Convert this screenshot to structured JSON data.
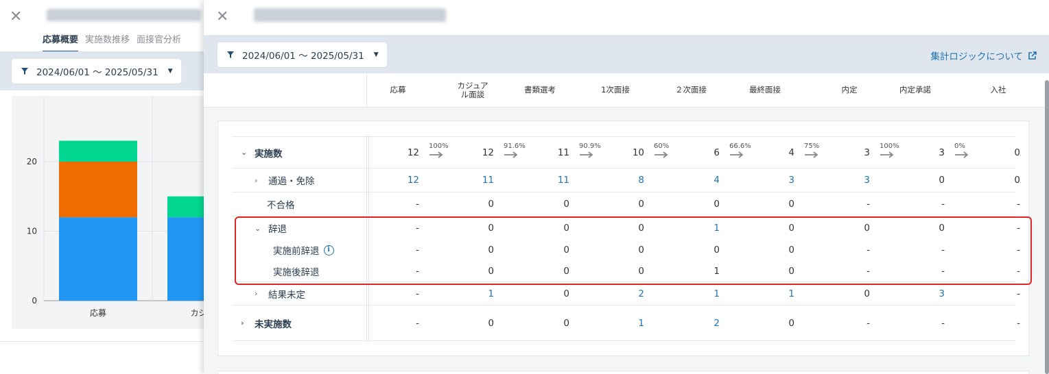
{
  "background": {
    "tabs": [
      {
        "label": "応募概要",
        "active": true
      },
      {
        "label": "実施数推移",
        "active": false
      },
      {
        "label": "面接官分析",
        "active": false
      }
    ],
    "date_filter": "2024/06/01 〜 2025/05/31",
    "chart_data": {
      "type": "bar",
      "stacked": true,
      "categories": [
        "応募",
        "カジュア"
      ],
      "series": [
        {
          "color": "#2196f3",
          "values": [
            12,
            12
          ]
        },
        {
          "color": "#ef6c00",
          "values": [
            8,
            0
          ]
        },
        {
          "color": "#00d68f",
          "values": [
            3,
            3
          ]
        }
      ],
      "yticks": [
        "0",
        "10",
        "20"
      ],
      "ylim": [
        0,
        26
      ],
      "grid": true
    }
  },
  "drawer": {
    "date_filter": "2024/06/01 〜 2025/05/31",
    "logic_link": "集計ロジックについて",
    "columns": [
      "応募",
      "カジュア\nル面談",
      "書類選考",
      "1次面接",
      "２次面接",
      "最終面接",
      "内定",
      "内定承諾",
      "入社"
    ],
    "rows": [
      {
        "label": "実施数",
        "chev": "⌄",
        "values": [
          "12",
          "12",
          "11",
          "10",
          "6",
          "4",
          "3",
          "3",
          "0"
        ],
        "rates": [
          "100%",
          "91.6%",
          "90.9%",
          "60%",
          "66.6%",
          "75%",
          "100%",
          "0%"
        ]
      },
      {
        "label": "通過・免除",
        "chev": "›",
        "values": [
          "12",
          "11",
          "11",
          "8",
          "4",
          "3",
          "3",
          "0",
          "0"
        ],
        "blue": [
          true,
          true,
          true,
          true,
          true,
          true,
          true,
          false,
          false
        ]
      },
      {
        "label": "不合格",
        "chev": "",
        "values": [
          "-",
          "0",
          "0",
          "0",
          "0",
          "0",
          "-",
          "-",
          "-"
        ]
      },
      {
        "label": "辞退",
        "chev": "⌄",
        "values": [
          "-",
          "0",
          "0",
          "0",
          "1",
          "0",
          "0",
          "0",
          "-"
        ],
        "blue": [
          false,
          false,
          false,
          false,
          true,
          false,
          false,
          false,
          false
        ]
      },
      {
        "label": "実施前辞退",
        "chev": "",
        "values": [
          "-",
          "0",
          "0",
          "0",
          "0",
          "0",
          "-",
          "-",
          "-"
        ]
      },
      {
        "label": "実施後辞退",
        "chev": "",
        "values": [
          "-",
          "0",
          "0",
          "0",
          "1",
          "0",
          "-",
          "-",
          "-"
        ]
      },
      {
        "label": "結果未定",
        "chev": "›",
        "values": [
          "-",
          "1",
          "0",
          "2",
          "1",
          "1",
          "0",
          "3",
          "-"
        ],
        "blue": [
          false,
          true,
          false,
          true,
          true,
          true,
          false,
          true,
          false
        ]
      },
      {
        "label": "未実施数",
        "chev": "›",
        "values": [
          "-",
          "0",
          "0",
          "1",
          "2",
          "0",
          "-",
          "-",
          "-"
        ],
        "blue": [
          false,
          false,
          false,
          true,
          true,
          false,
          false,
          false,
          false
        ]
      }
    ],
    "colors": {
      "link": "#1f74b8",
      "highlight": "#e02424"
    }
  }
}
